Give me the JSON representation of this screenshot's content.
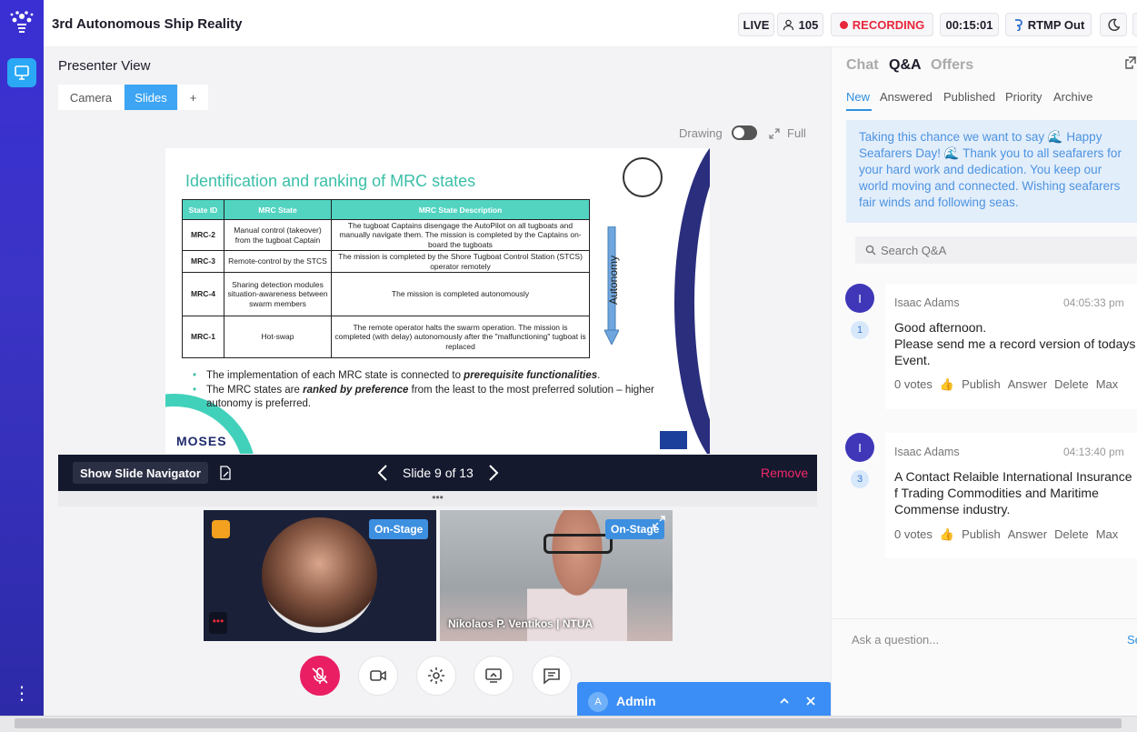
{
  "app": {
    "event_title": "3rd Autonomous Ship Reality"
  },
  "topbar": {
    "live_label": "LIVE",
    "viewers": "105",
    "recording_label": "RECORDING",
    "timer": "00:15:01",
    "rtmp_label": "RTMP Out"
  },
  "presenter": {
    "title": "Presenter View",
    "tabs": [
      {
        "label": "Camera",
        "active": false
      },
      {
        "label": "Slides",
        "active": true
      },
      {
        "label": "+",
        "active": false
      }
    ],
    "drawing_label": "Drawing",
    "drawing_on": false,
    "full_label": "Full"
  },
  "slide": {
    "title": "Identification and ranking of MRC states",
    "table_headers": [
      "State ID",
      "MRC State",
      "MRC State Description"
    ],
    "rows": [
      {
        "id": "MRC-2",
        "state": "Manual control (takeover) from the tugboat Captain",
        "desc": "The tugboat Captains disengage the AutoPilot on all tugboats and manually navigate them. The mission is completed by the Captains on-board the tugboats"
      },
      {
        "id": "MRC-3",
        "state": "Remote-control by the STCS",
        "desc": "The mission is completed by the Shore Tugboat Control Station (STCS) operator remotely"
      },
      {
        "id": "MRC-4",
        "state": "Sharing detection modules situation-awareness between swarm members",
        "desc": "The mission is completed autonomously"
      },
      {
        "id": "MRC-1",
        "state": "Hot-swap",
        "desc": "The remote operator halts the swarm operation. The mission is completed (with delay) autonomously after the \"malfunctioning\" tugboat is replaced"
      }
    ],
    "autonomy_label": "Autonomy",
    "bullet1_pre": "The implementation of each MRC state is connected to ",
    "bullet1_em": "prerequisite functionalities",
    "bullet1_post": ".",
    "bullet2_pre": "The MRC states are ",
    "bullet2_em": "ranked by preference",
    "bullet2_post": " from the least to the most preferred solution – higher autonomy is preferred.",
    "logo_text": "MOSES"
  },
  "slide_controls": {
    "show_navigator": "Show Slide Navigator",
    "counter": "Slide 9 of 13",
    "remove": "Remove",
    "grip": "•••"
  },
  "tiles": [
    {
      "badge": "On-Stage",
      "name": ""
    },
    {
      "badge": "On-Stage",
      "name": "Nikolaos P. Ventikos | NTUA"
    }
  ],
  "admin": {
    "avatar_letter": "A",
    "label": "Admin"
  },
  "rpanel": {
    "tabs": [
      {
        "label": "Chat",
        "active": false
      },
      {
        "label": "Q&A",
        "active": true
      },
      {
        "label": "Offers",
        "active": false
      }
    ],
    "subtabs": [
      {
        "label": "New",
        "active": true
      },
      {
        "label": "Answered",
        "active": false
      },
      {
        "label": "Published",
        "active": false
      },
      {
        "label": "Priority",
        "active": false
      },
      {
        "label": "Archive",
        "active": false
      }
    ],
    "pinned_message": "Taking this chance we want to say 🌊 Happy Seafarers Day! 🌊 Thank you to all seafarers for your hard work and dedication. You keep our world moving and connected. Wishing seafarers fair winds and following seas.",
    "search_placeholder": "Search Q&A",
    "questions": [
      {
        "avatar": "I",
        "count": "1",
        "name": "Isaac Adams",
        "time": "04:05:33 pm",
        "text": "Good afternoon.\nPlease send me a record version of todays Event.",
        "votes": "0 votes",
        "actions": [
          "Publish",
          "Answer",
          "Delete",
          "Max"
        ]
      },
      {
        "avatar": "I",
        "count": "3",
        "name": "Isaac Adams",
        "time": "04:13:40 pm",
        "text": "A Contact Relaible International Insurance f Trading Commodities and Maritime Commense industry.",
        "votes": "0 votes",
        "actions": [
          "Publish",
          "Answer",
          "Delete",
          "Max"
        ]
      }
    ],
    "ask_placeholder": "Ask a question...",
    "send_label": "Se"
  },
  "colors": {
    "sidebar": "#3a2fd3",
    "accent": "#3da5f4",
    "recording": "#e8263b",
    "remove": "#f2286a",
    "admin_bar": "#3b8ef5",
    "slide_teal": "#52d4c1"
  }
}
